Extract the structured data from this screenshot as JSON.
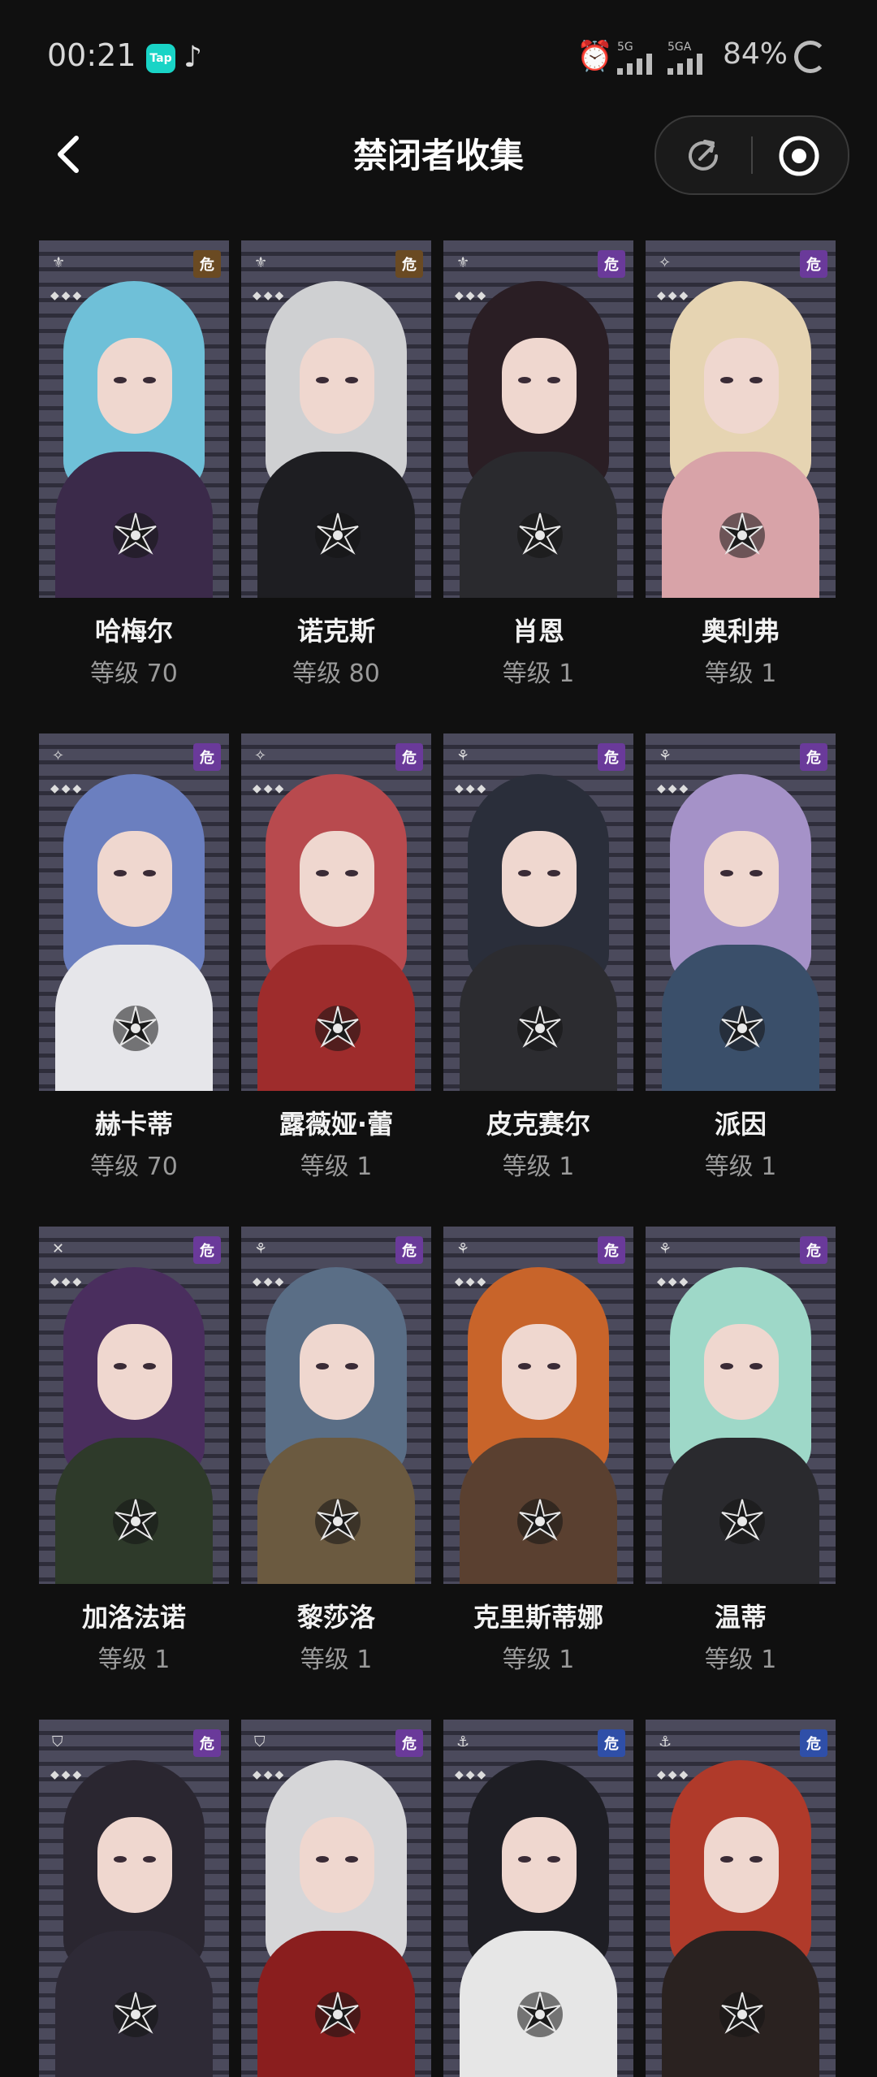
{
  "status_bar": {
    "time": "00:21",
    "tap_label": "Tap",
    "sig1_label": "5G",
    "sig2_label": "5GA",
    "battery": "84%"
  },
  "header": {
    "title": "禁闭者收集"
  },
  "cards": [
    {
      "name": "哈梅尔",
      "level": "等级 70",
      "badge": "危",
      "hair": "#6fc0d8",
      "body": "#3b2a4a"
    },
    {
      "name": "诺克斯",
      "level": "等级 80",
      "badge": "危",
      "hair": "#cfd0d2",
      "body": "#1e1e22"
    },
    {
      "name": "肖恩",
      "level": "等级 1",
      "badge": "危",
      "hair": "#2a1e24",
      "body": "#2a2a2e"
    },
    {
      "name": "奥利弗",
      "level": "等级 1",
      "badge": "危",
      "hair": "#e6d4b2",
      "body": "#d8a3a8"
    },
    {
      "name": "赫卡蒂",
      "level": "等级 70",
      "badge": "危",
      "hair": "#6b7fbf",
      "body": "#e6e6ea"
    },
    {
      "name": "露薇娅·蕾",
      "level": "等级 1",
      "badge": "危",
      "hair": "#b84a4e",
      "body": "#9e2c2c"
    },
    {
      "name": "皮克赛尔",
      "level": "等级 1",
      "badge": "危",
      "hair": "#2a2e3a",
      "body": "#2c2c30"
    },
    {
      "name": "派因",
      "level": "等级 1",
      "badge": "危",
      "hair": "#a592c8",
      "body": "#3a4f6a"
    },
    {
      "name": "加洛法诺",
      "level": "等级 1",
      "badge": "危",
      "hair": "#4a2e5e",
      "body": "#2e3a2a"
    },
    {
      "name": "黎莎洛",
      "level": "等级 1",
      "badge": "危",
      "hair": "#5a6e86",
      "body": "#6b5a40"
    },
    {
      "name": "克里斯蒂娜",
      "level": "等级 1",
      "badge": "危",
      "hair": "#c8642a",
      "body": "#5a4030"
    },
    {
      "name": "温蒂",
      "level": "等级 1",
      "badge": "危",
      "hair": "#9ed8c8",
      "body": "#2a2a2e"
    },
    {
      "name": "",
      "level": "",
      "badge": "危",
      "hair": "#2a2630",
      "body": "#2e2a36"
    },
    {
      "name": "",
      "level": "",
      "badge": "危",
      "hair": "#d6d6d8",
      "body": "#8a1e1e"
    },
    {
      "name": "",
      "level": "",
      "badge": "危",
      "hair": "#1e1e24",
      "body": "#e6e6e6"
    },
    {
      "name": "",
      "level": "",
      "badge": "危",
      "hair": "#b03a2a",
      "body": "#2a2220"
    }
  ],
  "colors": {
    "badge_gold": "#6a4a22",
    "badge_purple": "#6a3a9a",
    "badge_blue": "#2f4fa8"
  }
}
